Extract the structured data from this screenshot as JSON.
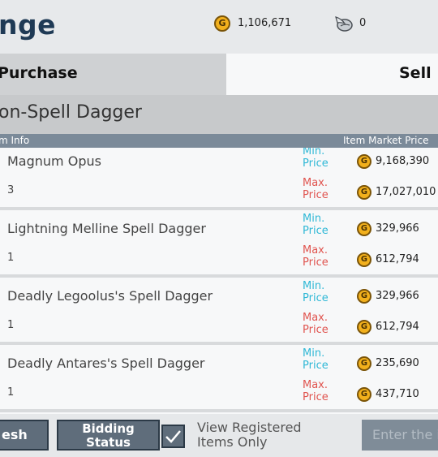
{
  "header": {
    "title": "nge",
    "gold_icon": "G",
    "gold_amount": "1,106,671",
    "feather_icon": "feather-icon",
    "feather_amount": "0"
  },
  "tabs": {
    "purchase": "Purchase",
    "sell": "Sell"
  },
  "category": "on-Spell Dagger",
  "columns": {
    "left": "m Info",
    "right": "Item Market Price"
  },
  "labels": {
    "min": "Min.\nPrice",
    "max": "Max.\nPrice",
    "coin": "G"
  },
  "items": [
    {
      "name": "Magnum Opus",
      "qty": "3",
      "min_price": "9,168,390",
      "max_price": "17,027,010"
    },
    {
      "name": "Lightning Melline Spell Dagger",
      "qty": "1",
      "min_price": "329,966",
      "max_price": "612,794"
    },
    {
      "name": "Deadly Legoolus's Spell Dagger",
      "qty": "1",
      "min_price": "329,966",
      "max_price": "612,794"
    },
    {
      "name": "Deadly Antares's Spell Dagger",
      "qty": "1",
      "min_price": "235,690",
      "max_price": "437,710"
    },
    {
      "name": "",
      "qty": "",
      "min_price": "",
      "max_price": ""
    }
  ],
  "bottom": {
    "refresh": "esh",
    "bidding_line1": "Bidding",
    "bidding_line2": "Status",
    "checkbox_label_line1": "View Registered",
    "checkbox_label_line2": "Items Only",
    "search_placeholder": "Enter the i"
  },
  "colors": {
    "min": "#2fb8d6",
    "max": "#e0544f",
    "title": "#1f3a55",
    "gold": "#f2b01c"
  }
}
